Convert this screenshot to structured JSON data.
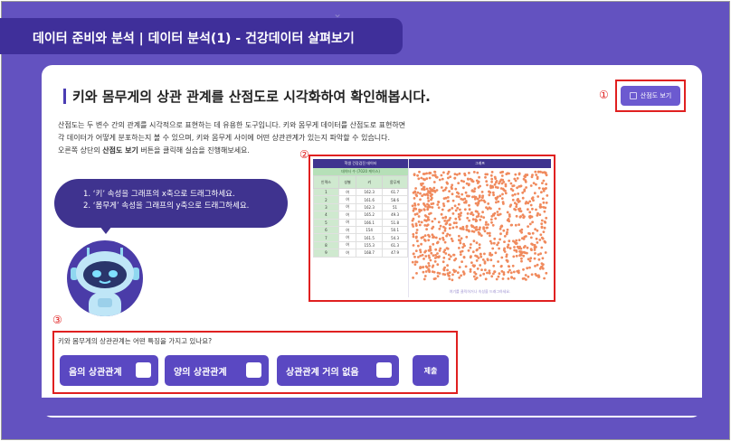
{
  "header": {
    "title": "데이터 준비와 분석 | 데이터 분석(1) - 건강데이터 살펴보기"
  },
  "main": {
    "heading": "키와 몸무게의 상관 관계를 산점도로 시각화하여 확인해봅시다.",
    "description": {
      "line1": "산점도는 두 변수 간의 관계를 시각적으로 표현하는 데 유용한 도구입니다. 키와 몸무게 데이터를 산점도로 표현하면",
      "line2": "각 데이터가 어떻게 분포하는지 볼 수 있으며, 키와 몸무게 사이에 어떤 상관관계가 있는지 파악할 수 있습니다.",
      "line3_pre": "오른쪽 상단의 ",
      "line3_bold": "산점도 보기",
      "line3_post": " 버튼을 클릭해 실습을 진행해보세요."
    },
    "scatter_button_label": "산점도 보기",
    "markers": {
      "m1": "①",
      "m2": "②",
      "m3": "③"
    },
    "bubble": {
      "line1": "1. ‘키’ 속성을 그래프의 x축으로 드래그하세요.",
      "line2": "2. ‘몸무게’ 속성을 그래프의  y축으로 드래그하세요."
    },
    "embedded_app": {
      "left_title": "학생 건강검진 데이터",
      "left_subtitle": "데이터 수 (7020 케이스)",
      "columns": [
        "인덱스",
        "성별",
        "키",
        "몸무게"
      ],
      "rows": [
        [
          "1",
          "여",
          "162.3",
          "61.7"
        ],
        [
          "2",
          "여",
          "161.6",
          "58.6"
        ],
        [
          "3",
          "여",
          "162.3",
          "51"
        ],
        [
          "4",
          "여",
          "165.2",
          "49.3"
        ],
        [
          "5",
          "여",
          "166.1",
          "51.8"
        ],
        [
          "6",
          "여",
          "154",
          "50.1"
        ],
        [
          "7",
          "여",
          "161.5",
          "54.3"
        ],
        [
          "8",
          "여",
          "155.3",
          "61.3"
        ],
        [
          "9",
          "여",
          "168.7",
          "47.9"
        ]
      ],
      "right_title": "그래프",
      "footer_hint": "여기를 클릭하거나 속성을 드래그하세요."
    },
    "quiz": {
      "question": "키와 몸무게의 상관관계는 어떤 특징을 가지고 있나요?",
      "options": [
        "음의 상관관계",
        "양의 상관관계",
        "상관관계 거의 없음"
      ],
      "submit": "제출"
    }
  }
}
